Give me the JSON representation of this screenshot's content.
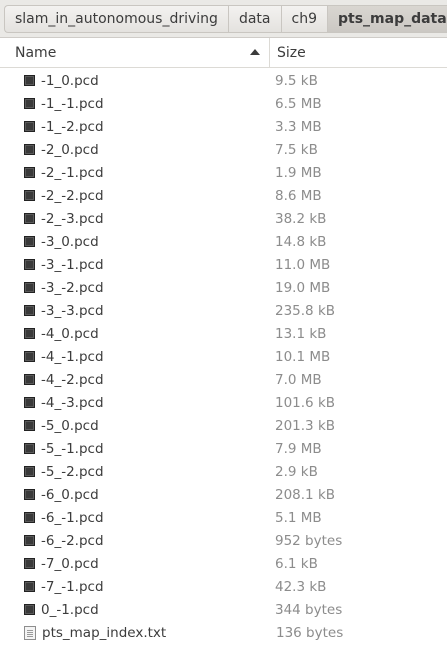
{
  "breadcrumb": [
    "slam_in_autonomous_driving",
    "data",
    "ch9",
    "pts_map_data"
  ],
  "columns": {
    "name": "Name",
    "size": "Size"
  },
  "files": [
    {
      "name": "-1_0.pcd",
      "size": "9.5 kB",
      "icon": "pcd-file-icon"
    },
    {
      "name": "-1_-1.pcd",
      "size": "6.5 MB",
      "icon": "pcd-file-icon"
    },
    {
      "name": "-1_-2.pcd",
      "size": "3.3 MB",
      "icon": "pcd-file-icon"
    },
    {
      "name": "-2_0.pcd",
      "size": "7.5 kB",
      "icon": "pcd-file-icon"
    },
    {
      "name": "-2_-1.pcd",
      "size": "1.9 MB",
      "icon": "pcd-file-icon"
    },
    {
      "name": "-2_-2.pcd",
      "size": "8.6 MB",
      "icon": "pcd-file-icon"
    },
    {
      "name": "-2_-3.pcd",
      "size": "38.2 kB",
      "icon": "pcd-file-icon"
    },
    {
      "name": "-3_0.pcd",
      "size": "14.8 kB",
      "icon": "pcd-file-icon"
    },
    {
      "name": "-3_-1.pcd",
      "size": "11.0 MB",
      "icon": "pcd-file-icon"
    },
    {
      "name": "-3_-2.pcd",
      "size": "19.0 MB",
      "icon": "pcd-file-icon"
    },
    {
      "name": "-3_-3.pcd",
      "size": "235.8 kB",
      "icon": "pcd-file-icon"
    },
    {
      "name": "-4_0.pcd",
      "size": "13.1 kB",
      "icon": "pcd-file-icon"
    },
    {
      "name": "-4_-1.pcd",
      "size": "10.1 MB",
      "icon": "pcd-file-icon"
    },
    {
      "name": "-4_-2.pcd",
      "size": "7.0 MB",
      "icon": "pcd-file-icon"
    },
    {
      "name": "-4_-3.pcd",
      "size": "101.6 kB",
      "icon": "pcd-file-icon"
    },
    {
      "name": "-5_0.pcd",
      "size": "201.3 kB",
      "icon": "pcd-file-icon"
    },
    {
      "name": "-5_-1.pcd",
      "size": "7.9 MB",
      "icon": "pcd-file-icon"
    },
    {
      "name": "-5_-2.pcd",
      "size": "2.9 kB",
      "icon": "pcd-file-icon"
    },
    {
      "name": "-6_0.pcd",
      "size": "208.1 kB",
      "icon": "pcd-file-icon"
    },
    {
      "name": "-6_-1.pcd",
      "size": "5.1 MB",
      "icon": "pcd-file-icon"
    },
    {
      "name": "-6_-2.pcd",
      "size": "952 bytes",
      "icon": "pcd-file-icon"
    },
    {
      "name": "-7_0.pcd",
      "size": "6.1 kB",
      "icon": "pcd-file-icon"
    },
    {
      "name": "-7_-1.pcd",
      "size": "42.3 kB",
      "icon": "pcd-file-icon"
    },
    {
      "name": "0_-1.pcd",
      "size": "344 bytes",
      "icon": "pcd-file-icon"
    },
    {
      "name": "pts_map_index.txt",
      "size": "136 bytes",
      "icon": "text-file-icon"
    }
  ]
}
